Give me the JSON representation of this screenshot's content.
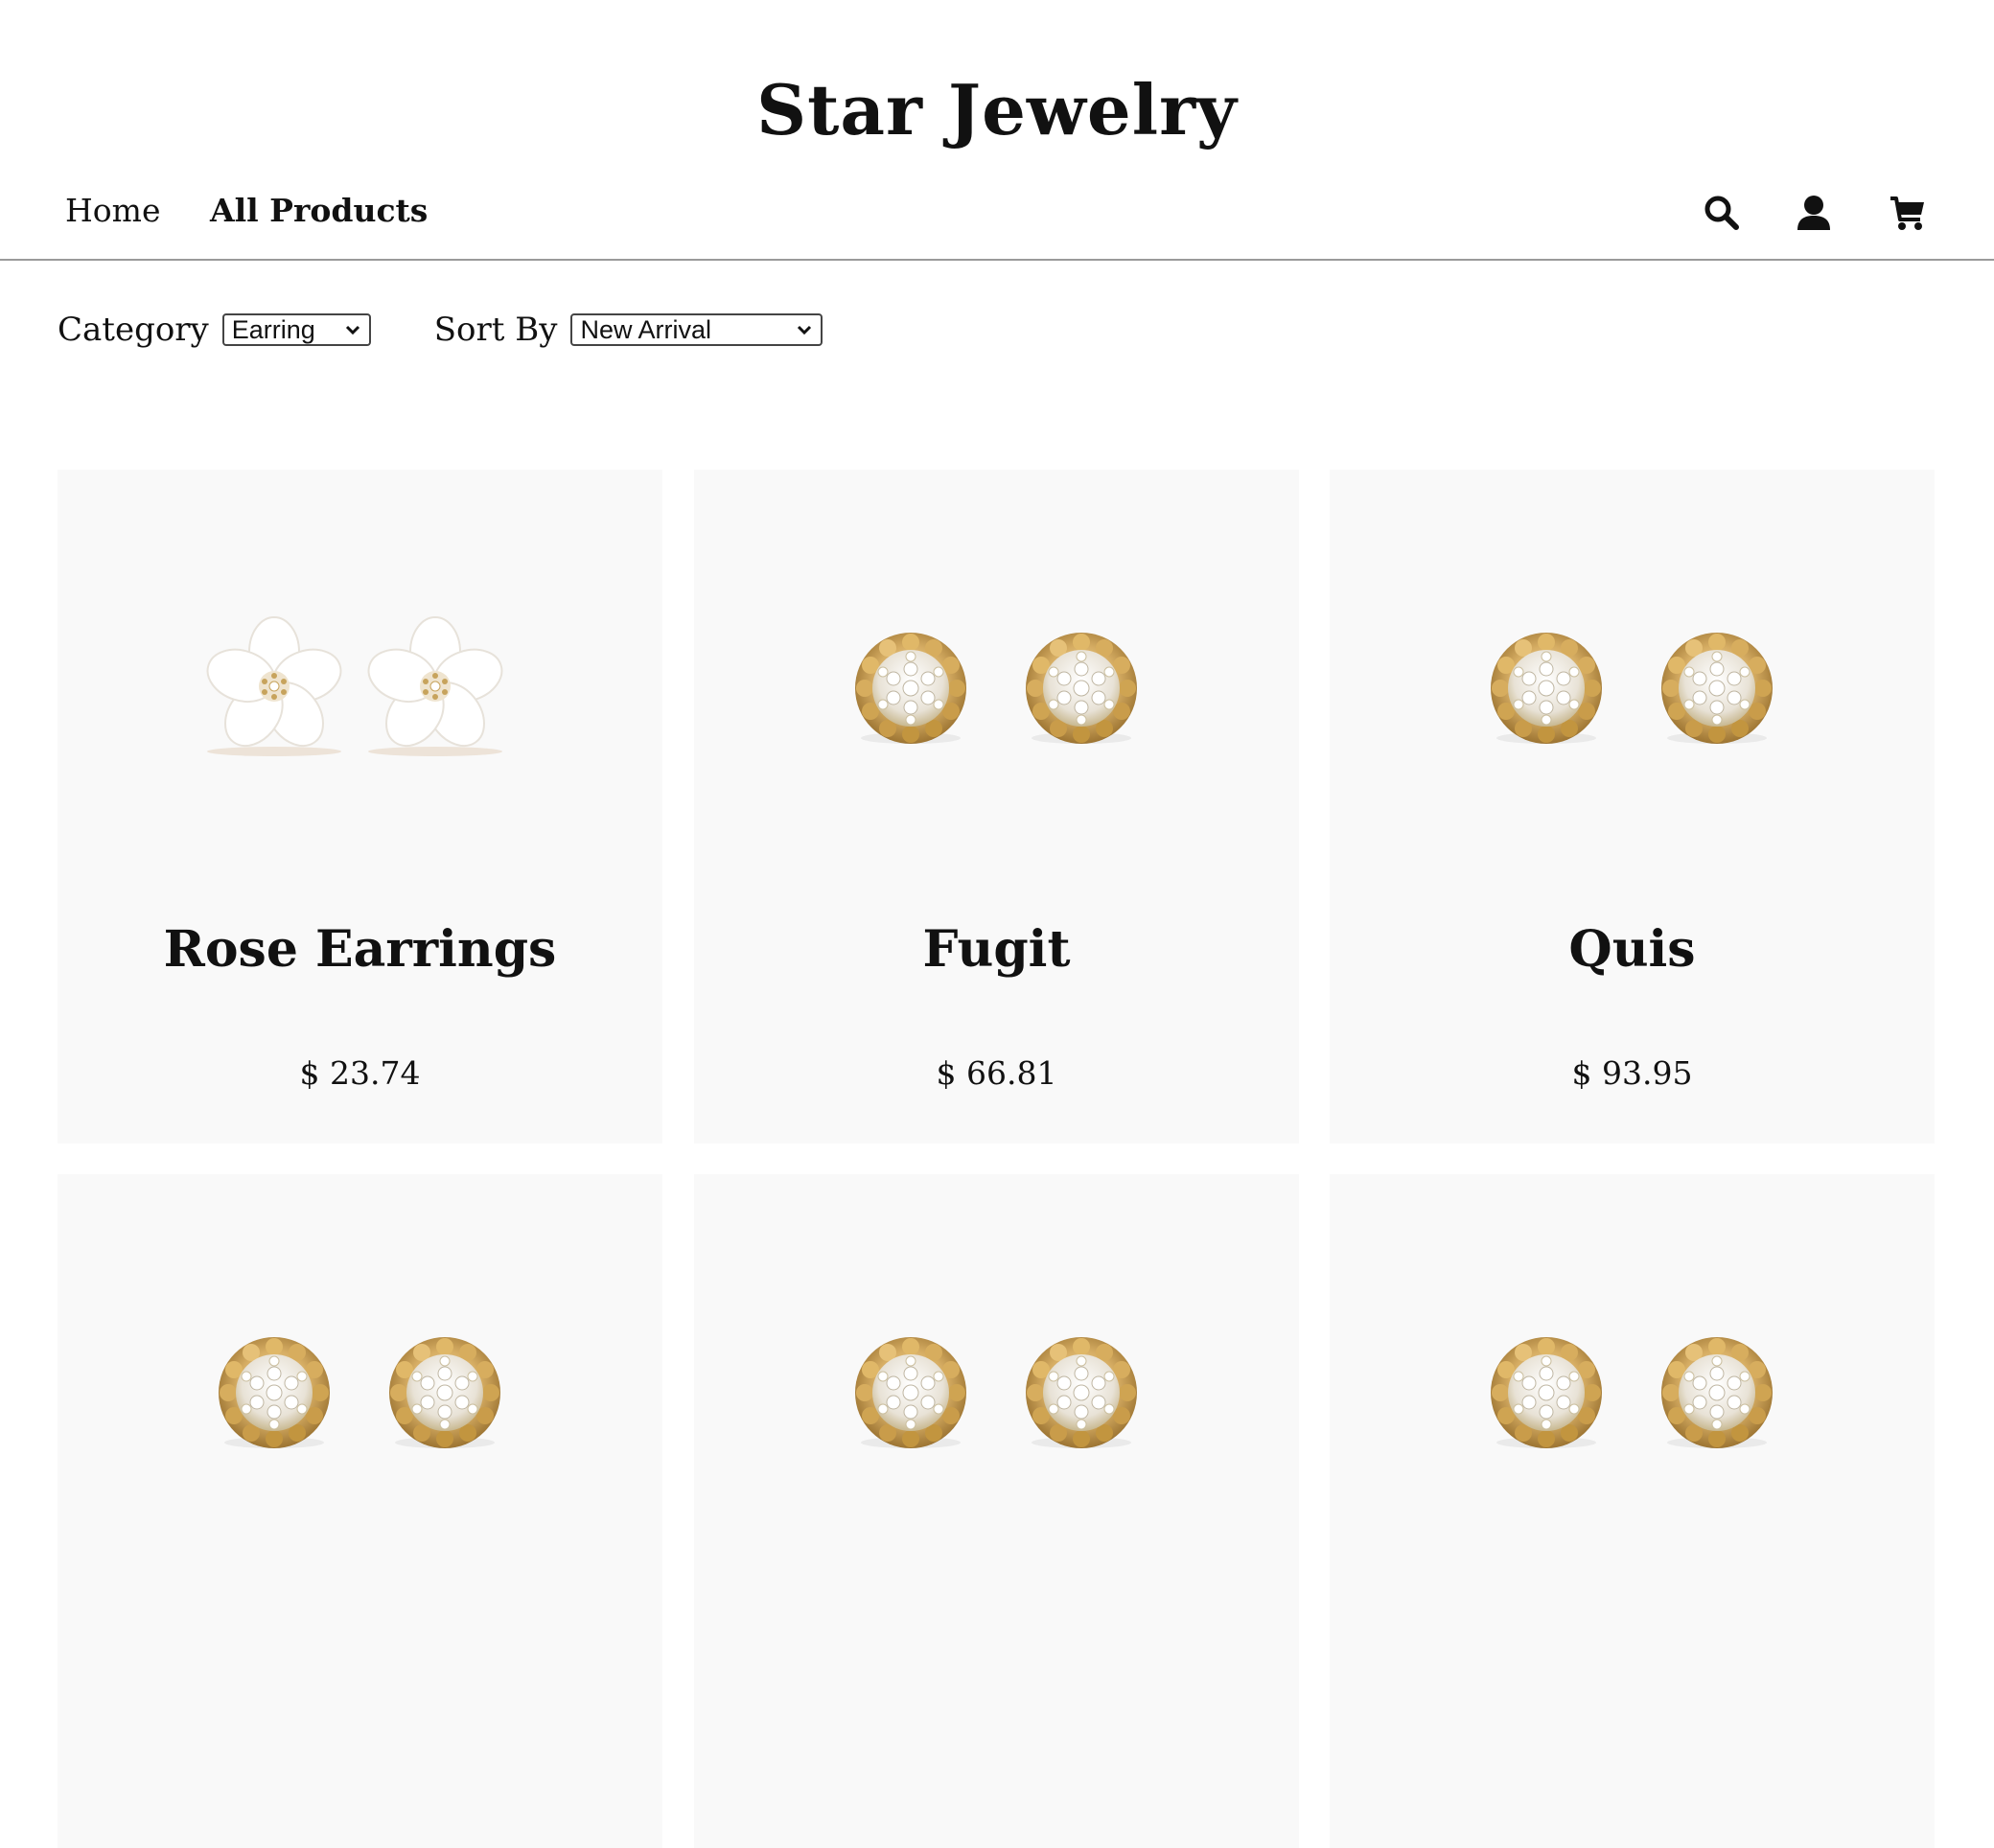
{
  "site": {
    "title": "Star Jewelry"
  },
  "nav": {
    "home_label": "Home",
    "all_products_label": "All Products"
  },
  "header_icons": [
    "search-icon",
    "account-icon",
    "cart-icon"
  ],
  "filters": {
    "category_label": "Category",
    "category_value": "Earring",
    "sort_label": "Sort By",
    "sort_value": "New Arrival"
  },
  "products": [
    {
      "name": "Rose Earrings",
      "price": "$ 23.74",
      "image": "flower-earrings-image"
    },
    {
      "name": "Fugit",
      "price": "$ 66.81",
      "image": "gold-diamond-earrings-image"
    },
    {
      "name": "Quis",
      "price": "$ 93.95",
      "image": "gold-diamond-earrings-image"
    },
    {
      "name": "",
      "price": "",
      "image": "gold-diamond-earrings-image"
    },
    {
      "name": "",
      "price": "",
      "image": "gold-diamond-earrings-image"
    },
    {
      "name": "",
      "price": "",
      "image": "gold-diamond-earrings-image"
    }
  ],
  "colors": {
    "card_bg": "#f9f9f9",
    "gold": "#c9a15a",
    "divider": "#9a9a9a"
  }
}
